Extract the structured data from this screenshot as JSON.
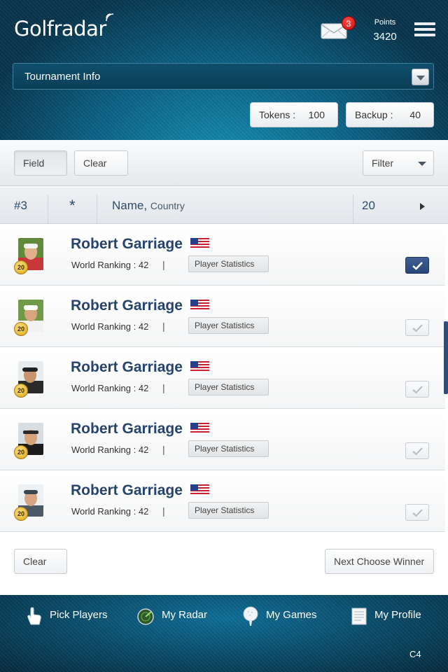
{
  "app": {
    "logo_text": "Golfradar",
    "mail_count": "3",
    "points_label": "Points",
    "points_value": "3420"
  },
  "tournament": {
    "selected": "Tournament Info"
  },
  "tokens": {
    "tokens_label": "Tokens :",
    "tokens_value": "100",
    "backup_label": "Backup :",
    "backup_value": "40"
  },
  "toolbar": {
    "field_label": "Field",
    "clear_label": "Clear",
    "filter_label": "Filter"
  },
  "table_header": {
    "rank": "#3",
    "star": "*",
    "name": "Name,",
    "country": "Country",
    "count": "20"
  },
  "players": [
    {
      "name": "Robert Garriage",
      "ranking": "World Ranking : 42",
      "pipe": "|",
      "stats_label": "Player Statistics",
      "badge": "20",
      "checked": true
    },
    {
      "name": "Robert Garriage",
      "ranking": "World Ranking : 42",
      "pipe": "|",
      "stats_label": "Player Statistics",
      "badge": "20",
      "checked": false
    },
    {
      "name": "Robert Garriage",
      "ranking": "World Ranking : 42",
      "pipe": "|",
      "stats_label": "Player Statistics",
      "badge": "20",
      "checked": false
    },
    {
      "name": "Robert Garriage",
      "ranking": "World Ranking : 42",
      "pipe": "|",
      "stats_label": "Player Statistics",
      "badge": "20",
      "checked": false
    },
    {
      "name": "Robert Garriage",
      "ranking": "World Ranking : 42",
      "pipe": "|",
      "stats_label": "Player Statistics",
      "badge": "20",
      "checked": false
    }
  ],
  "footer": {
    "clear_label": "Clear",
    "next_label": "Next Choose Winner"
  },
  "nav": {
    "pick_players": "Pick Players",
    "my_radar": "My Radar",
    "my_games": "My Games",
    "my_profile": "My Profile",
    "screen_code": "C4"
  },
  "colors": {
    "accent_navy": "#26436b",
    "header_teal": "#0b5f82",
    "badge_red": "#c90d0d",
    "check_on": "#284678"
  }
}
